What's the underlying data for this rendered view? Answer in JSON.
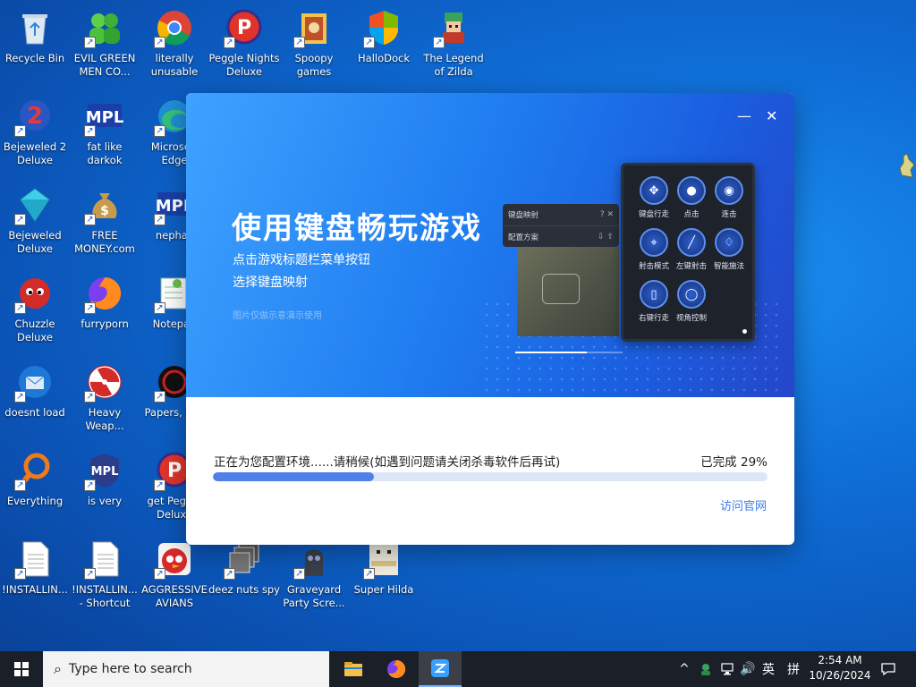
{
  "desktop": {
    "icons": [
      {
        "label": "Recycle Bin",
        "icon": "recycle-bin-icon"
      },
      {
        "label": "EVIL GREEN MEN CO...",
        "icon": "green-men-icon"
      },
      {
        "label": "literally unusable",
        "icon": "chrome-icon"
      },
      {
        "label": "Peggle Nights Deluxe",
        "icon": "peggle-icon"
      },
      {
        "label": "Spoopy games",
        "icon": "folder-icon"
      },
      {
        "label": "HalloDock",
        "icon": "shield-icon"
      },
      {
        "label": "The Legend of Zilda",
        "icon": "zilda-icon"
      },
      {
        "label": "Bejeweled 2 Deluxe",
        "icon": "bejeweled2-icon"
      },
      {
        "label": "fat like darkok",
        "icon": "mpl-icon"
      },
      {
        "label": "Microsoft Edge",
        "icon": "edge-icon"
      },
      {
        "label": "Bejeweled Deluxe",
        "icon": "gem-icon"
      },
      {
        "label": "FREE MONEY.com",
        "icon": "money-bag-icon"
      },
      {
        "label": "nephac",
        "icon": "mpl-icon"
      },
      {
        "label": "Chuzzle Deluxe",
        "icon": "chuzzle-icon"
      },
      {
        "label": "furryporn",
        "icon": "firefox-icon"
      },
      {
        "label": "Notepad",
        "icon": "notepad-icon"
      },
      {
        "label": "doesnt load",
        "icon": "thunderbird-icon"
      },
      {
        "label": "Heavy Weap...",
        "icon": "radiation-icon"
      },
      {
        "label": "Papers, Pl...",
        "icon": "papers-icon"
      },
      {
        "label": "Everything",
        "icon": "search-icon"
      },
      {
        "label": "is very",
        "icon": "mpl-shield-icon"
      },
      {
        "label": "get Peggle Deluxe",
        "icon": "peggle-icon"
      },
      {
        "label": "!INSTALLIN...",
        "icon": "document-icon"
      },
      {
        "label": "!INSTALLIN... - Shortcut",
        "icon": "document-icon"
      },
      {
        "label": "AGGRESSIVE AVIANS",
        "icon": "angry-bird-icon"
      },
      {
        "label": "deez nuts spy",
        "icon": "stack-icon"
      },
      {
        "label": "Graveyard Party Scre...",
        "icon": "graveyard-icon"
      },
      {
        "label": "Super Hilda",
        "icon": "hilda-icon"
      }
    ]
  },
  "app": {
    "minimize": "—",
    "close": "✕",
    "headline": "使用键盘畅玩游戏",
    "sub1": "点击游戏标题栏菜单按钮",
    "sub2": "选择键盘映射",
    "note": "图片仅做示意演示使用",
    "mapping_panel": {
      "title": "键盘映射",
      "title_icons": "? ✕",
      "scheme": "配置方案",
      "scheme_icons": "⇩ ⇧"
    },
    "keys": [
      {
        "label": "键盘行走",
        "glyph": "✥"
      },
      {
        "label": "点击",
        "glyph": "●"
      },
      {
        "label": "连击",
        "glyph": "◉"
      },
      {
        "label": "射击模式",
        "glyph": "⌖"
      },
      {
        "label": "左键射击",
        "glyph": "╱"
      },
      {
        "label": "智能施法",
        "glyph": "♢"
      },
      {
        "label": "右键行走",
        "glyph": "▯"
      },
      {
        "label": "视角控制",
        "glyph": "◯"
      }
    ],
    "status": "正在为您配置环境......请稍候(如遇到问题请关闭杀毒软件后再试)",
    "progress_label": "已完成 29%",
    "progress": 0.29,
    "visit_link": "访问官网",
    "accent": "#4f7fe8"
  },
  "taskbar": {
    "search_placeholder": "Type here to search",
    "apps": [
      "file-explorer-icon",
      "firefox-icon",
      "app-icon"
    ],
    "tray": {
      "chevron": "^",
      "network_icon": "network-icon",
      "volume": "🔊",
      "lang": "英",
      "ime": "拼"
    },
    "time": "2:54 AM",
    "date": "10/26/2024"
  }
}
